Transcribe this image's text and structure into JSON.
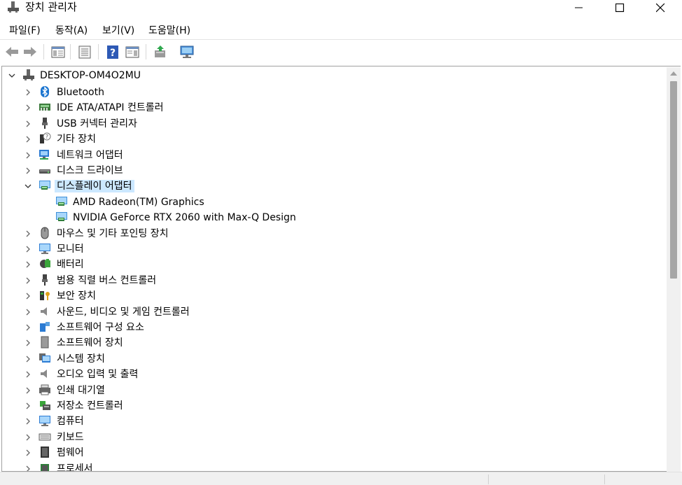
{
  "window": {
    "title": "장치 관리자",
    "minimize_glyph": "—",
    "maximize_glyph": "□",
    "close_glyph": "✕"
  },
  "menu": [
    {
      "label": "파일(F)"
    },
    {
      "label": "동작(A)"
    },
    {
      "label": "보기(V)"
    },
    {
      "label": "도움말(H)"
    }
  ],
  "toolbar": {
    "buttons": [
      "back-icon",
      "forward-icon",
      "show-hide-console-tree-icon",
      "properties-icon",
      "help-icon",
      "action-pane-icon",
      "update-driver-icon",
      "scan-hardware-icon"
    ]
  },
  "tree": {
    "root": "DESKTOP-OM4O2MU",
    "items": [
      {
        "label": "Bluetooth",
        "icon": "bluetooth-icon",
        "expanded": false
      },
      {
        "label": "IDE ATA/ATAPI 컨트롤러",
        "icon": "ide-controller-icon",
        "expanded": false
      },
      {
        "label": "USB 커넥터 관리자",
        "icon": "usb-connector-icon",
        "expanded": false
      },
      {
        "label": "기타 장치",
        "icon": "unknown-device-icon",
        "expanded": false
      },
      {
        "label": "네트워크 어댑터",
        "icon": "network-adapter-icon",
        "expanded": false
      },
      {
        "label": "디스크 드라이브",
        "icon": "disk-drive-icon",
        "expanded": false
      },
      {
        "label": "디스플레이 어댑터",
        "icon": "display-adapter-icon",
        "expanded": true,
        "selected": true,
        "children": [
          {
            "label": "AMD Radeon(TM) Graphics",
            "icon": "display-adapter-icon"
          },
          {
            "label": "NVIDIA GeForce RTX 2060 with Max-Q Design",
            "icon": "display-adapter-icon"
          }
        ]
      },
      {
        "label": "마우스 및 기타 포인팅 장치",
        "icon": "mouse-icon",
        "expanded": false
      },
      {
        "label": "모니터",
        "icon": "monitor-icon",
        "expanded": false
      },
      {
        "label": "배터리",
        "icon": "battery-icon",
        "expanded": false
      },
      {
        "label": "범용 직렬 버스 컨트롤러",
        "icon": "usb-controller-icon",
        "expanded": false
      },
      {
        "label": "보안 장치",
        "icon": "security-device-icon",
        "expanded": false
      },
      {
        "label": "사운드, 비디오 및 게임 컨트롤러",
        "icon": "sound-icon",
        "expanded": false
      },
      {
        "label": "소프트웨어 구성 요소",
        "icon": "software-component-icon",
        "expanded": false
      },
      {
        "label": "소프트웨어 장치",
        "icon": "software-device-icon",
        "expanded": false
      },
      {
        "label": "시스템 장치",
        "icon": "system-device-icon",
        "expanded": false
      },
      {
        "label": "오디오 입력 및 출력",
        "icon": "audio-io-icon",
        "expanded": false
      },
      {
        "label": "인쇄 대기열",
        "icon": "print-queue-icon",
        "expanded": false
      },
      {
        "label": "저장소 컨트롤러",
        "icon": "storage-controller-icon",
        "expanded": false
      },
      {
        "label": "컴퓨터",
        "icon": "computer-icon",
        "expanded": false
      },
      {
        "label": "키보드",
        "icon": "keyboard-icon",
        "expanded": false
      },
      {
        "label": "펌웨어",
        "icon": "firmware-icon",
        "expanded": false
      },
      {
        "label": "프로세서",
        "icon": "processor-icon",
        "expanded": false
      }
    ]
  },
  "colors": {
    "selection": "#cce8ff",
    "scroll_thumb": "#a6a6a6"
  }
}
